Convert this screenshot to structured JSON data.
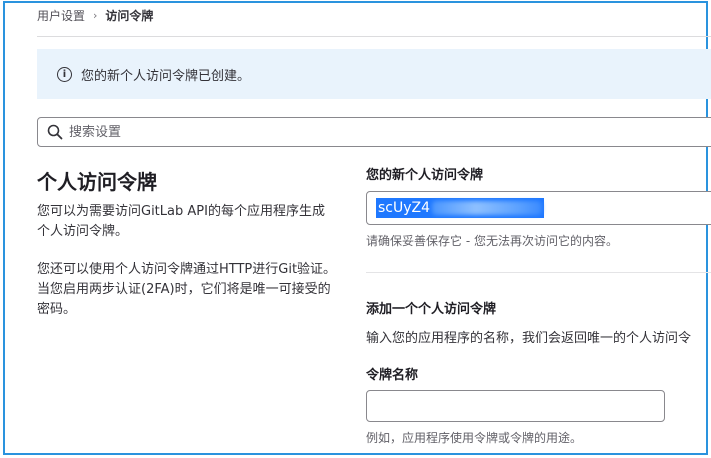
{
  "breadcrumb": {
    "parent": "用户设置",
    "separator": "›",
    "current": "访问令牌"
  },
  "alert": {
    "icon": "info-icon",
    "icon_glyph": "i",
    "message": "您的新个人访问令牌已创建。"
  },
  "search": {
    "icon": "search-icon",
    "placeholder": "搜索设置"
  },
  "left": {
    "title": "个人访问令牌",
    "paragraph1": "您可以为需要访问GitLab API的每个应用程序生成个人访问令牌。",
    "paragraph2": "您还可以使用个人访问令牌通过HTTP进行Git验证。 当您启用两步认证(2FA)时，它们将是唯一可接受的密码。"
  },
  "new_token": {
    "label": "您的新个人访问令牌",
    "value_visible": "scUyZ4",
    "hint": "请确保妥善保存它 - 您无法再次访问它的内容。"
  },
  "add_token": {
    "title": "添加一个个人访问令牌",
    "description": "输入您的应用程序的名称，我们会返回唯一的个人访问令",
    "name_label": "令牌名称",
    "name_value": "",
    "name_hint": "例如，应用程序使用令牌或令牌的用途。"
  },
  "colors": {
    "frame": "#2a93de",
    "alert_bg": "#e9f3fc",
    "selection": "#1f78ff"
  }
}
